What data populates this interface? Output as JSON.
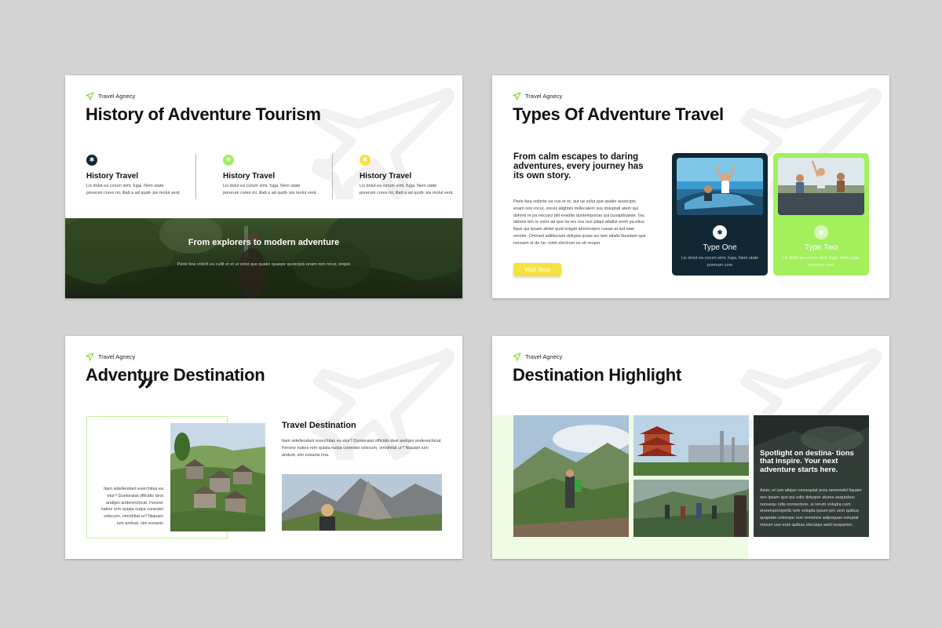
{
  "brand": {
    "name": "Travel Agnecy",
    "accent": "#a3f05c",
    "dark": "#112733",
    "yellow": "#f5e142"
  },
  "slide1": {
    "title": "History of Adventure Tourism",
    "columns": [
      {
        "heading": "History Travel",
        "body": "Lis dolut ea corum simi, fuga. Nem utate porerum cores mi, illab a ad quidi- pis molut vent.",
        "dot_color": "#112733"
      },
      {
        "heading": "History Travel",
        "body": "Lis dolut ea corum simi, fuga. Nem utate porerum cores mi, illab a ad quidi- pis molut vent.",
        "dot_color": "#a3f05c"
      },
      {
        "heading": "History Travel",
        "body": "Lis dolut ea corum simi, fuga. Nem utate porerum cores mi, illab a ad quidi- pis molut vent.",
        "dot_color": "#f5e142"
      }
    ],
    "banner_title": "From explorers to modern adventure",
    "banner_body": "Parie bea volorit ea cullit et et ut volut que quatio quaspe quoscipis enam non rocur, orepis"
  },
  "slide2": {
    "title": "Types Of Adventure Travel",
    "lead": "From calm escapes to daring adventures, every journey has its own story.",
    "body": "Parie bea volorite ea cus et et, aut ue volut que quatio quoscipis enam non rocur, orevis aligtmis millecatem sus doluptati atem qui dolenit re pa necusci plit evadite duntemporias qui cusapibusiae. Ga, laborie bm re volor ad que lia res ovu nus pliqui atlatist enim pa etius llque qui ipsam abitet quid evigati aborecepro coeae at aut eiae omnim. Ommed adiitiscium dolupta quiae aci tem aitalis lbusdam que nonsam et de he- nimil electrum es sit vesper",
    "button": "Visit Now",
    "cards": [
      {
        "label": "Type One",
        "body": "Lis dolut ea corum simi, fuga. Nem utate porerum core"
      },
      {
        "label": "Type Two",
        "body": "Lis dolut ea corum simi, fuga. Nem utate porerum core"
      }
    ]
  },
  "slide3": {
    "title": "Adventure Destination",
    "quote_mark": "”",
    "quote": "Itam videllendant exerchitas ea etur? Duntoratat officidis dest andigni andereichicat. Ferorer natios rem quiata nulpa conestet volecum, omnihitat ur? Niquam ium andust, sim eosanis",
    "heading": "Travel Destination",
    "body": "Itam videllendant exerchitas ea etur? Duntoratat officidis dest andigni andereichicat. Ferorer natios rem quiata nulpa conestet volecum, omnihitat ur? Niquam ium andust, sim eosanis ima."
  },
  "slide4": {
    "title": "Destination Highlight",
    "spot_title": "Spotlight on destina- tions that inspire. Your next adventure starts here.",
    "spot_body": "Asim, et ium alique ronsequiat pora nemendel liquam nes ipsam quo qui odio doluipor atures asquisbus nonsequ odis nonsectore, si rerum volupta cum eturemporepellic tem volupta ipsum pro sem quibus quaptate volorepe rum remolore adipsquas voluptat minum uos-eum quibus etecaqui aetd nuspanim."
  }
}
